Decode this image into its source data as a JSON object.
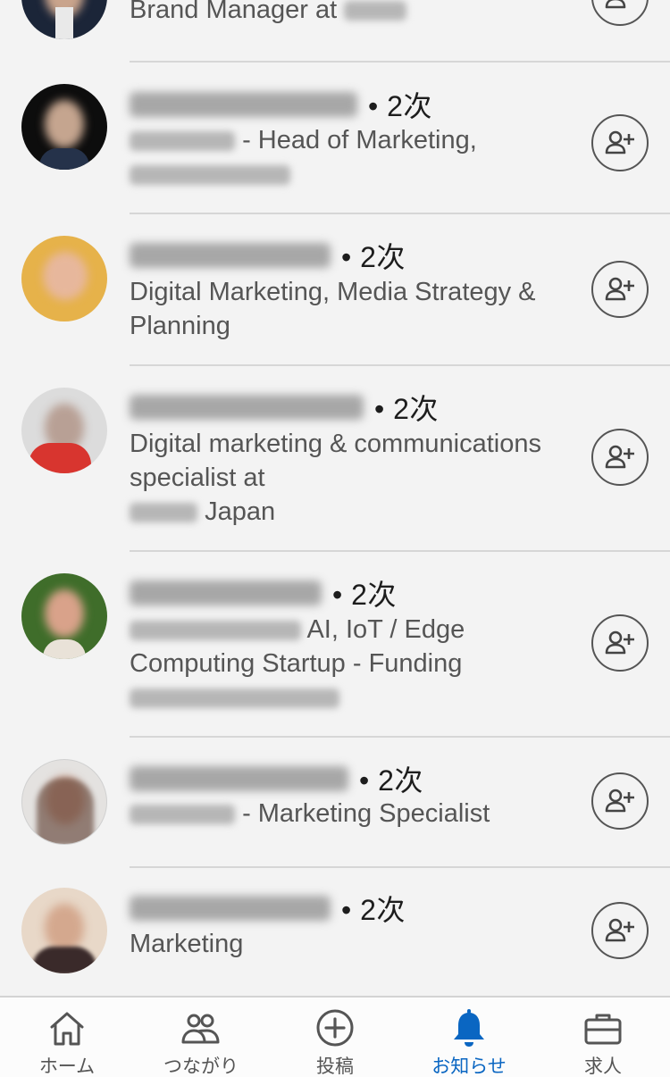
{
  "people": [
    {
      "degree": "",
      "headline_text": "Brand Manager at",
      "blur_before": false,
      "blur_after": true,
      "avatar_color": "#1b2538"
    },
    {
      "degree": "• 2次",
      "headline_text": "- Head of Marketing,",
      "blur_before": true,
      "blur_after": false,
      "avatar_color": "#0d0d0d"
    },
    {
      "degree": "• 2次",
      "headline_text": "Digital Marketing, Media Strategy & Planning",
      "blur_before": false,
      "blur_after": false,
      "avatar_color": "#d9a640"
    },
    {
      "degree": "• 2次",
      "headline_text": "Digital marketing & communications specialist at",
      "headline_text_2": "Japan",
      "blur_before": false,
      "blur_after": false,
      "avatar_color": "#d94a4a"
    },
    {
      "degree": "• 2次",
      "headline_text": "AI, IoT / Edge Computing Startup - Funding",
      "blur_before": true,
      "blur_after": false,
      "avatar_color": "#3f6d2a"
    },
    {
      "degree": "• 2次",
      "headline_text": "- Marketing Specialist",
      "blur_before": true,
      "blur_after": false,
      "avatar_color": "#c8c4c0"
    },
    {
      "degree": "• 2次",
      "headline_text": "Marketing",
      "blur_before": false,
      "blur_after": false,
      "avatar_color": "#c49a7a"
    }
  ],
  "tabs": [
    {
      "label": "ホーム",
      "icon": "home-icon",
      "active": false
    },
    {
      "label": "つながり",
      "icon": "people-icon",
      "active": false
    },
    {
      "label": "投稿",
      "icon": "post-plus-icon",
      "active": false
    },
    {
      "label": "お知らせ",
      "icon": "bell-icon",
      "active": true
    },
    {
      "label": "求人",
      "icon": "briefcase-icon",
      "active": false
    }
  ],
  "colors": {
    "accent": "#0a66c2",
    "background": "#f3f3f3",
    "text": "#1d1d1d",
    "subtext": "#555555"
  }
}
